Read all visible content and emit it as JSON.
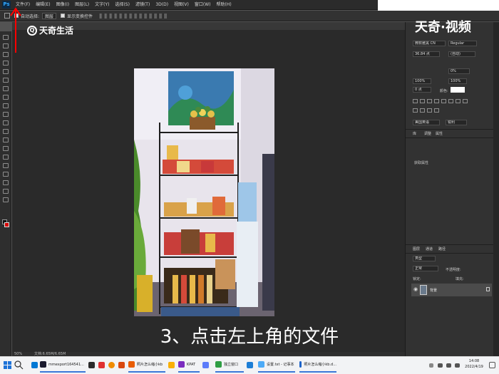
{
  "menu": {
    "items": [
      "文件(F)",
      "编辑(E)",
      "图像(I)",
      "图层(L)",
      "文字(Y)",
      "选择(S)",
      "滤镜(T)",
      "3D(D)",
      "视图(V)",
      "窗口(W)",
      "帮助(H)"
    ]
  },
  "options": {
    "auto_select_label": "自动选择:",
    "auto_select_value": "图层",
    "show_transform_label": "显示变换控件"
  },
  "character_panel": {
    "font_family": "微软雅黑 CN",
    "font_style": "Regular",
    "font_size": "36.84 点",
    "leading": "(自动)",
    "tracking": "0%",
    "scale_v": "100%",
    "scale_h": "100%",
    "baseline": "0 点",
    "color_label": "颜色:",
    "language": "美国英语",
    "antialias": "锐利"
  },
  "panels": {
    "tab_library": "库",
    "tab_adjust": "调整",
    "tab_props": "属性",
    "tab_layers": "图层",
    "tab_channels": "通道",
    "tab_paths": "路径",
    "kind_label": "类型",
    "normal": "正常",
    "opacity": "不透明度:",
    "lock": "锁定:",
    "fill": "填充:",
    "no_props": "获取属性"
  },
  "layers": {
    "items": [
      {
        "name": "背景"
      }
    ]
  },
  "status": {
    "zoom": "50%",
    "doc": "文档:6.65M/6.65M"
  },
  "watermark": {
    "left": "天奇生活",
    "right": "天奇·视频"
  },
  "caption": "3、点击左上角的文件",
  "taskbar": {
    "apps": [
      {
        "label": "mmexport164541...",
        "color": "#1a1a2e"
      },
      {
        "label": "照片怎么缩小kb",
        "color": "#e85d04"
      },
      {
        "label": "KPAT",
        "color": "#7b2cbf"
      },
      {
        "label": "独立窗口",
        "color": "#2f9e44"
      },
      {
        "label": "设置.txt - 记事本",
        "color": "#4dabf7"
      },
      {
        "label": "照片怎么缩小kb.d...",
        "color": "#1c63c9"
      }
    ],
    "time": "14:08",
    "date": "2022/4/19"
  },
  "colors": {
    "accent": "#ff0000",
    "ps_blue": "#31a8ff"
  }
}
